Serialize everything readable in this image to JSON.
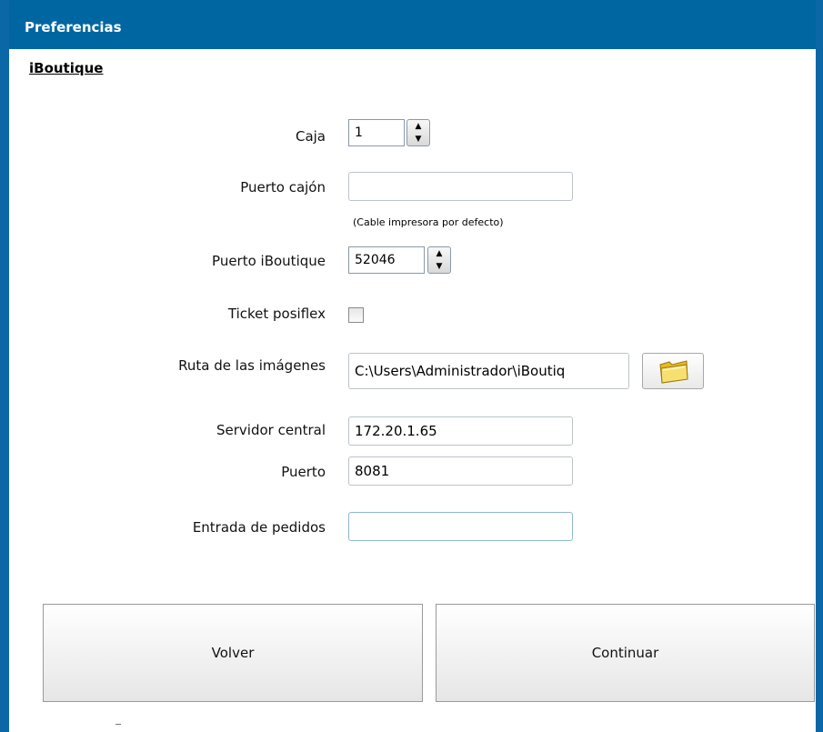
{
  "window": {
    "title": "Preferencias"
  },
  "section": {
    "title": "iBoutique"
  },
  "form": {
    "caja": {
      "label": "Caja",
      "value": "1"
    },
    "puerto_cajon": {
      "label": "Puerto cajón",
      "value": "",
      "hint": "(Cable impresora por defecto)"
    },
    "puerto_iboutique": {
      "label": "Puerto iBoutique",
      "value": "52046"
    },
    "ticket_posiflex": {
      "label": "Ticket posiflex",
      "checked": false
    },
    "ruta_imagenes": {
      "label": "Ruta de las imágenes",
      "value": "C:\\Users\\Administrador\\iBoutiq"
    },
    "servidor_central": {
      "label": "Servidor central",
      "value": "172.20.1.65"
    },
    "puerto": {
      "label": "Puerto",
      "value": "8081"
    },
    "entrada_pedidos": {
      "label": "Entrada de pedidos",
      "value": ""
    }
  },
  "buttons": {
    "back_label": "Volver",
    "continue_label": "Continuar"
  },
  "icons": {
    "folder": "folder-icon",
    "spin_up": "spin-up-icon",
    "spin_down": "spin-down-icon"
  },
  "colors": {
    "titlebar": "#0066a1",
    "border": "#0b67a6",
    "folder_yellow": "#f5d640"
  }
}
